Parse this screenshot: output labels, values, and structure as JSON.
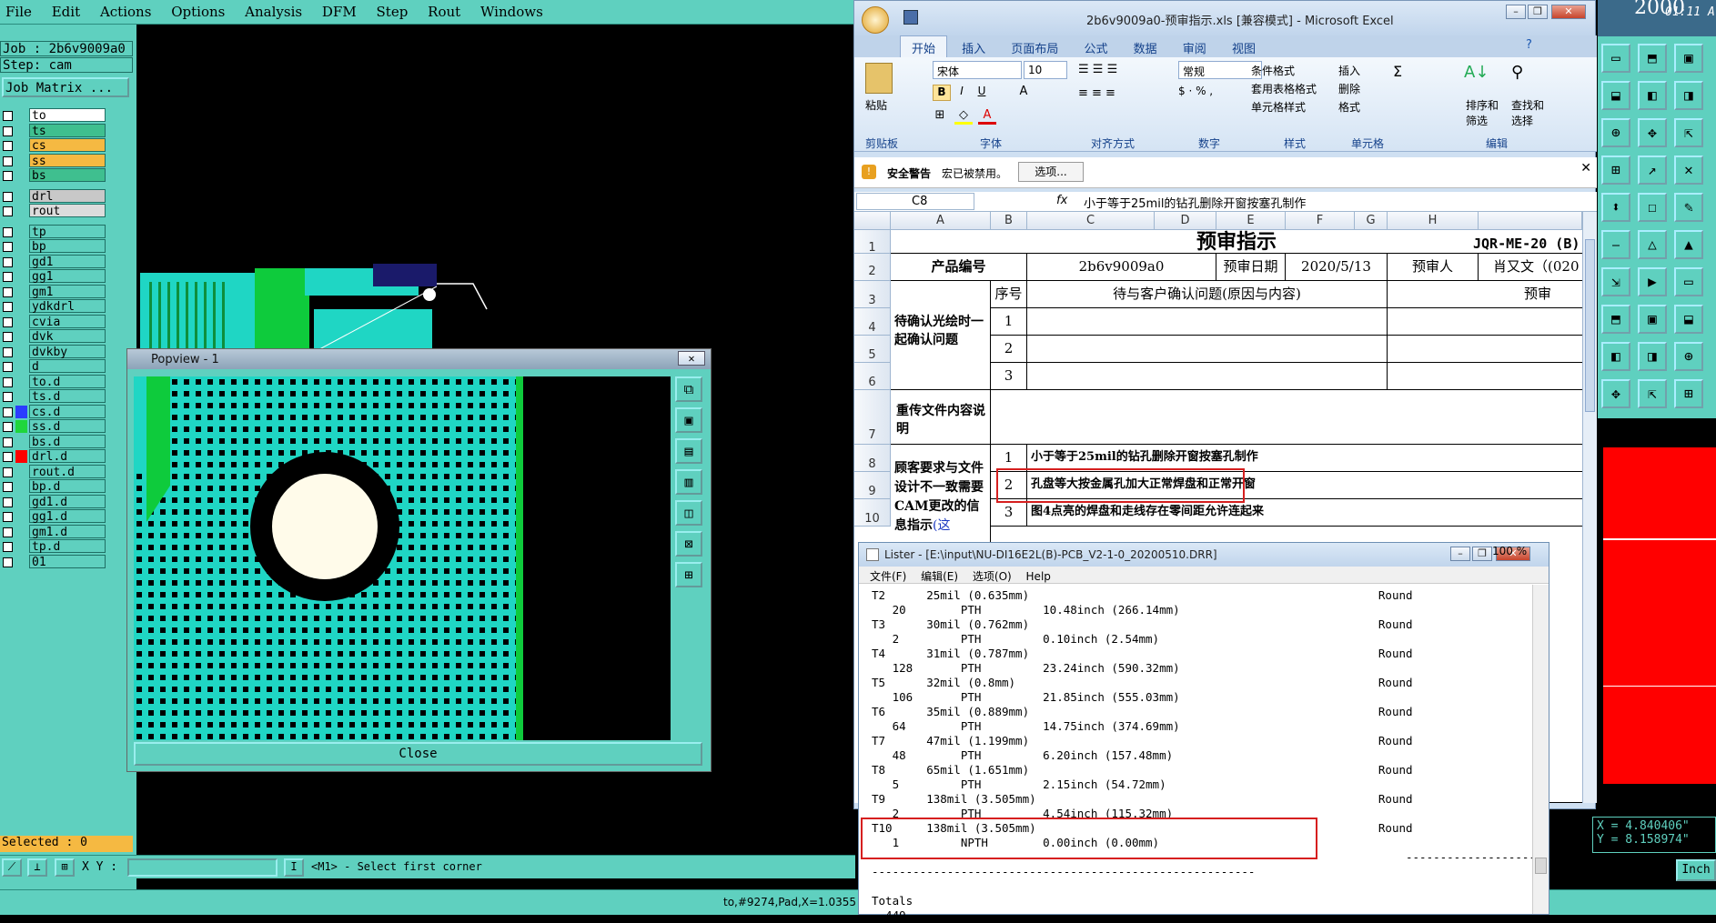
{
  "genesis": {
    "menu": [
      "File",
      "Edit",
      "Actions",
      "Options",
      "Analysis",
      "DFM",
      "Step",
      "Rout",
      "Windows"
    ],
    "job_label": "Job : 2b6v9009a0",
    "step_label": "Step: cam",
    "job_matrix_label": "Job Matrix ...",
    "layers": [
      {
        "name": "to",
        "color": "#ffffff"
      },
      {
        "name": "ts",
        "color": "#3fbf8f"
      },
      {
        "name": "cs",
        "color": "#f5b942"
      },
      {
        "name": "ss",
        "color": "#f5b942"
      },
      {
        "name": "bs",
        "color": "#3fbf8f"
      },
      {
        "name": "drl",
        "color": "#c8c8c8"
      },
      {
        "name": "rout",
        "color": "#dcdcdc"
      },
      {
        "name": "tp",
        "color": ""
      },
      {
        "name": "bp",
        "color": ""
      },
      {
        "name": "gd1",
        "color": ""
      },
      {
        "name": "gg1",
        "color": ""
      },
      {
        "name": "gm1",
        "color": ""
      },
      {
        "name": "ydkdrl",
        "color": ""
      },
      {
        "name": "cvia",
        "color": ""
      },
      {
        "name": "dvk",
        "color": ""
      },
      {
        "name": "dvkby",
        "color": ""
      },
      {
        "name": "d",
        "color": ""
      },
      {
        "name": "to.d",
        "color": ""
      },
      {
        "name": "ts.d",
        "color": ""
      },
      {
        "name": "cs.d",
        "color": ""
      },
      {
        "name": "ss.d",
        "color": ""
      },
      {
        "name": "bs.d",
        "color": ""
      },
      {
        "name": "drl.d",
        "color": ""
      },
      {
        "name": "rout.d",
        "color": ""
      },
      {
        "name": "bp.d",
        "color": ""
      },
      {
        "name": "gd1.d",
        "color": ""
      },
      {
        "name": "gg1.d",
        "color": ""
      },
      {
        "name": "gm1.d",
        "color": ""
      },
      {
        "name": "tp.d",
        "color": ""
      },
      {
        "name": "01",
        "color": ""
      }
    ],
    "selected_label": "Selected : 0",
    "xy_label": "X Y :",
    "prompt": "<M1> - Select first corner",
    "status_text": "to,#9274,Pad,X=1.0355",
    "coord_x": "X = 4.840406\"",
    "coord_y": "Y = 8.158974\"",
    "unit_label": "Inch",
    "clock": "01:11 A",
    "logo_text": "2000"
  },
  "popview": {
    "title": "Popview - 1",
    "close_label": "Close"
  },
  "excel": {
    "title": "2b6v9009a0-预审指示.xls [兼容模式] - Microsoft Excel",
    "tabs": [
      "开始",
      "插入",
      "页面布局",
      "公式",
      "数据",
      "审阅",
      "视图"
    ],
    "font_name": "宋体",
    "font_size": "10",
    "number_format": "常规",
    "ribbon_groups": [
      "剪贴板",
      "字体",
      "对齐方式",
      "数字",
      "样式",
      "单元格",
      "编辑"
    ],
    "ribbon_labels": {
      "paste": "粘贴",
      "cond_format": "条件格式",
      "table_format": "套用表格格式",
      "cell_style": "单元格样式",
      "insert": "插入",
      "delete": "删除",
      "format": "格式",
      "sort": "排序和筛选",
      "find": "查找和选择"
    },
    "security_warning": "安全警告",
    "macro_disabled": "宏已被禁用。",
    "options_button": "选项...",
    "name_box": "C8",
    "fx": "fx",
    "formula": "小于等于25mil的钻孔删除开窗按塞孔制作",
    "columns": [
      "A",
      "B",
      "C",
      "D",
      "E",
      "F",
      "G",
      "H"
    ],
    "rows": [
      "1",
      "2",
      "3",
      "4",
      "5",
      "6",
      "7",
      "8",
      "9",
      "10"
    ],
    "sheet_title": "预审指示",
    "doc_code": "JQR-ME-20 (B)",
    "product_no_label": "产品编号",
    "product_no": "2b6v9009a0",
    "review_date_label": "预审日期",
    "review_date": "2020/5/13",
    "reviewer_label": "预审人",
    "reviewer": "肖又文（(020",
    "pending_label": "待确认光绘时一起确认问题",
    "seq_label": "序号",
    "issue_header": "待与客户确认问题(原因与内容)",
    "review_header": "预审",
    "seq": [
      "1",
      "2",
      "3"
    ],
    "reupload_label": "重传文件内容说明",
    "cam_label": "顾客要求与文件设计不一致需要CAM更改的信息指示",
    "cam_label_tail": "(这",
    "cam_items": [
      {
        "no": "1",
        "text": "小于等于25mil的钻孔删除开窗按塞孔制作"
      },
      {
        "no": "2",
        "text": "孔盘等大按金属孔加大正常焊盘和正常开窗"
      },
      {
        "no": "3",
        "text": "图4点亮的焊盘和走线存在零间距允许连起来"
      }
    ]
  },
  "lister": {
    "title": "Lister - [E:\\input\\NU-DI16E2L(B)-PCB_V2-1-0_20200510.DRR]",
    "menu": [
      "文件(F)",
      "编辑(E)",
      "选项(O)",
      "Help"
    ],
    "zoom": "100 %",
    "lines": [
      "T2      25mil (0.635mm)                                                   Round",
      "   20        PTH         10.48inch (266.14mm)",
      "T3      30mil (0.762mm)                                                   Round",
      "   2         PTH         0.10inch (2.54mm)",
      "T4      31mil (0.787mm)                                                   Round",
      "   128       PTH         23.24inch (590.32mm)",
      "T5      32mil (0.8mm)                                                     Round",
      "   106       PTH         21.85inch (555.03mm)",
      "T6      35mil (0.889mm)                                                   Round",
      "   64        PTH         14.75inch (374.69mm)",
      "T7      47mil (1.199mm)                                                   Round",
      "   48        PTH         6.20inch (157.48mm)",
      "T8      65mil (1.651mm)                                                   Round",
      "   5         PTH         2.15inch (54.72mm)",
      "T9      138mil (3.505mm)                                                  Round",
      "   2         PTH         4.54inch (115.32mm)",
      "T10     138mil (3.505mm)                                                  Round",
      "   1         NPTH        0.00inch (0.00mm)",
      "                                                                              -------------------",
      "--------------------------------------------------------",
      "",
      "Totals",
      "  449"
    ]
  }
}
